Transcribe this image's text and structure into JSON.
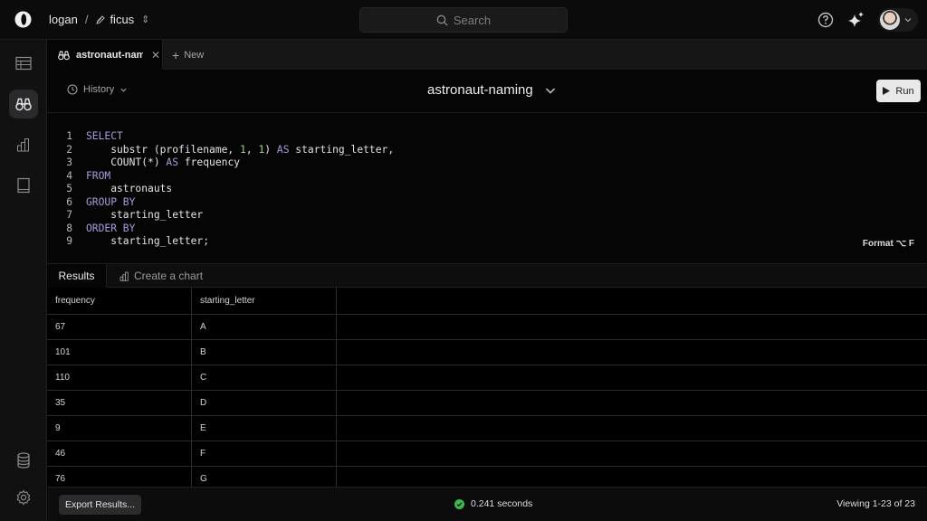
{
  "topbar": {
    "breadcrumb_user": "logan",
    "breadcrumb_separator": "/",
    "project_name": "ficus",
    "search_placeholder": "Search"
  },
  "tabs": {
    "active_tab_label": "astronaut-naming",
    "new_tab_label": "New"
  },
  "toolbar": {
    "history_label": "History",
    "query_title": "astronaut-naming",
    "run_label": "Run"
  },
  "editor": {
    "line_numbers": [
      "1",
      "2",
      "3",
      "4",
      "5",
      "6",
      "7",
      "8",
      "9"
    ],
    "lines": [
      [
        {
          "t": "SELECT",
          "c": "kw"
        }
      ],
      [
        {
          "t": "    substr (profilename, ",
          "c": ""
        },
        {
          "t": "1",
          "c": "num"
        },
        {
          "t": ", ",
          "c": ""
        },
        {
          "t": "1",
          "c": "num"
        },
        {
          "t": ") ",
          "c": ""
        },
        {
          "t": "AS",
          "c": "kw"
        },
        {
          "t": " starting_letter,",
          "c": ""
        }
      ],
      [
        {
          "t": "    COUNT(*) ",
          "c": ""
        },
        {
          "t": "AS",
          "c": "kw"
        },
        {
          "t": " frequency",
          "c": ""
        }
      ],
      [
        {
          "t": "FROM",
          "c": "kw"
        }
      ],
      [
        {
          "t": "    astronauts",
          "c": ""
        }
      ],
      [
        {
          "t": "GROUP BY",
          "c": "kw"
        }
      ],
      [
        {
          "t": "    starting_letter",
          "c": ""
        }
      ],
      [
        {
          "t": "ORDER BY",
          "c": "kw"
        }
      ],
      [
        {
          "t": "    starting_letter;",
          "c": ""
        }
      ]
    ],
    "format_label": "Format ⌥ F"
  },
  "results": {
    "tabs": {
      "results_label": "Results",
      "chart_label": "Create a chart"
    },
    "columns": [
      "frequency",
      "starting_letter"
    ],
    "rows": [
      [
        "67",
        "A"
      ],
      [
        "101",
        "B"
      ],
      [
        "110",
        "C"
      ],
      [
        "35",
        "D"
      ],
      [
        "9",
        "E"
      ],
      [
        "46",
        "F"
      ],
      [
        "76",
        "G"
      ]
    ]
  },
  "footer": {
    "export_label": "Export Results...",
    "duration": "0.241 seconds",
    "viewing": "Viewing 1-23 of 23"
  },
  "colors": {
    "keyword": "#a79bde",
    "number": "#9ccf8a",
    "success": "#3fb950"
  }
}
